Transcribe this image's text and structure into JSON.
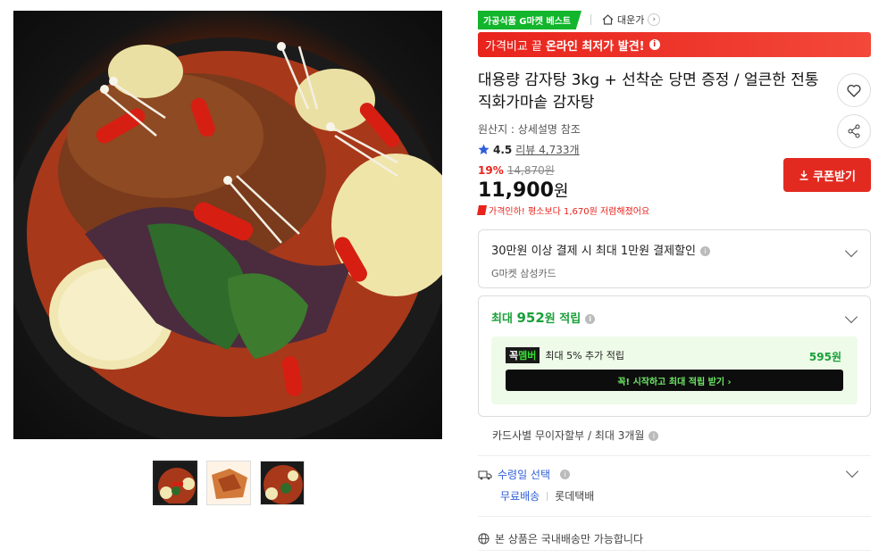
{
  "badges": {
    "best_label": "가공식품 G마켓 베스트",
    "seller_name": "대운가"
  },
  "price_banner": {
    "prefix": "가격비교 끝",
    "bold": "온라인 최저가 발견!"
  },
  "product": {
    "title": "대용량 감자탕 3kg + 선착순 당면 증정 / 얼큰한 전통 직화가마솥 감자탕",
    "origin": "원산지 : 상세설명 참조",
    "rating": "4.5",
    "reviews": "리뷰 4,733개"
  },
  "price": {
    "discount": "19%",
    "original": "14,870원",
    "sale": "11,900",
    "won": "원",
    "cut_notice": "가격인하! 평소보다 1,670원 저렴해졌어요",
    "coupon_label": "쿠폰받기"
  },
  "card_discount": {
    "title": "30만원 이상 결제 시 최대 1만원 결제할인",
    "subtitle": "G마켓 삼성카드"
  },
  "points": {
    "prefix": "최대",
    "amount": "952",
    "suffix": "원 적립",
    "member_badge_a": "꼭",
    "member_badge_b": "멤버",
    "member_text": "최대 5% 추가 적립",
    "member_points": "595원",
    "member_button": "꼭! 시작하고 최대 적립 받기  ›"
  },
  "installment": "카드사별 무이자할부 / 최대 3개월",
  "delivery": {
    "title": "수령일 선택",
    "free": "무료배송",
    "carrier": "롯데택배"
  },
  "domestic": "본 상품은 국내배송만 가능합니다",
  "colors": {
    "accent_red": "#e22a21",
    "green": "#1aa03a",
    "blue": "#2f5ed8"
  }
}
